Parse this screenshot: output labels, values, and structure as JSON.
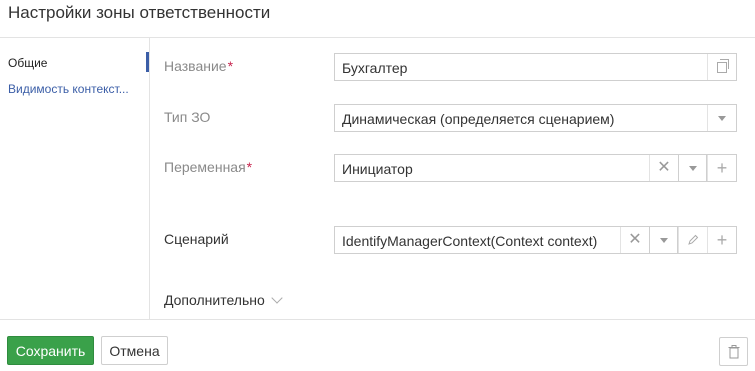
{
  "dialog": {
    "title": "Настройки зоны ответственности"
  },
  "sidebar": {
    "items": [
      {
        "label": "Общие"
      },
      {
        "label": "Видимость контекст..."
      }
    ]
  },
  "form": {
    "name": {
      "label": "Название",
      "required_mark": "*",
      "value": "Бухгалтер"
    },
    "zone_type": {
      "label": "Тип ЗО",
      "value": "Динамическая (определяется сценарием)"
    },
    "variable": {
      "label": "Переменная",
      "required_mark": "*",
      "value": "Инициатор"
    },
    "scenario": {
      "label": "Сценарий",
      "value": "IdentifyManagerContext(Context context)"
    },
    "advanced": {
      "label": "Дополнительно"
    }
  },
  "icons": {
    "copy": "copy-icon",
    "dropdown": "chevron-down-icon",
    "clear": "close-icon",
    "add": "plus-icon",
    "edit": "pencil-icon",
    "delete": "trash-icon"
  },
  "footer": {
    "save_label": "Сохранить",
    "cancel_label": "Отмена"
  },
  "colors": {
    "accent": "#3b5ea7",
    "save_button": "#3aa14a",
    "required": "#c7254e"
  }
}
